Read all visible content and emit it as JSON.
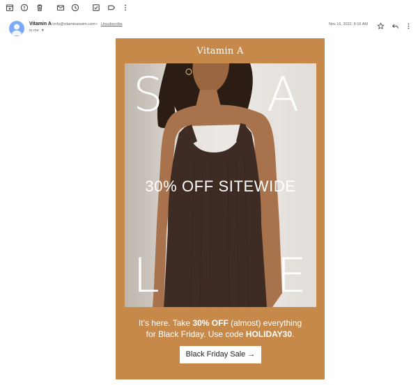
{
  "toolbar": {
    "icons": [
      "archive-icon",
      "report-spam-icon",
      "delete-icon",
      "mark-unread-icon",
      "snooze-icon",
      "add-to-tasks-icon",
      "label-icon",
      "more-vert-icon"
    ]
  },
  "message": {
    "sender_name": "Vitamin A",
    "sender_email": "<info@vitaminaswim.com>",
    "unsubscribe_label": "Unsubscribe",
    "recipient": "to me",
    "date": "Nov 16, 2022, 8:16 AM"
  },
  "email": {
    "brand": "Vitamin A",
    "hero_letters": [
      "S",
      "A",
      "L",
      "E"
    ],
    "hero_headline": "30% OFF SITEWIDE",
    "promo_line1_start": "It’s here. Take ",
    "promo_highlight1": "30% OFF",
    "promo_line1_end": " (almost) everything",
    "promo_line2_start": "for Black Friday. Use code ",
    "promo_code": "HOLIDAY30",
    "promo_line2_end": ".",
    "cta_label": "Black Friday Sale →"
  },
  "colors": {
    "email_background": "#c7894a",
    "avatar": "#7baaf7",
    "dress": "#3e2b23",
    "skin": "#a8734c"
  }
}
